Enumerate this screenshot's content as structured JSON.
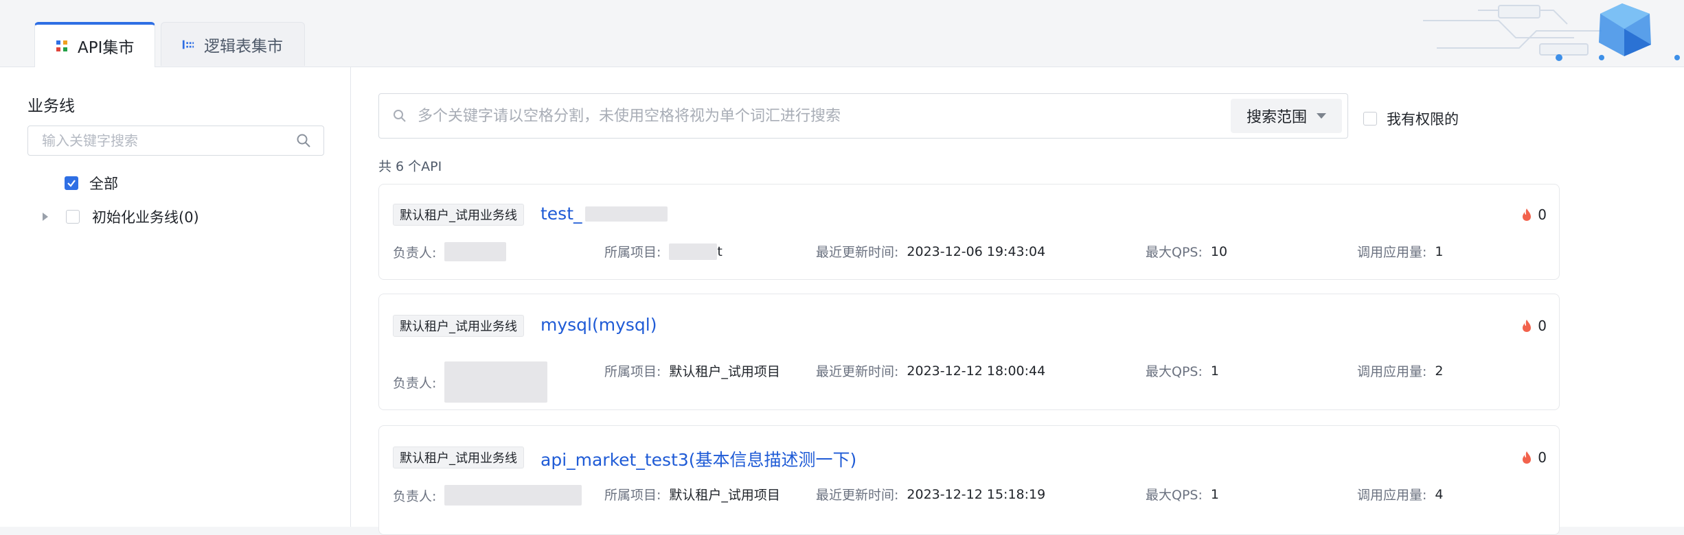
{
  "tabs": [
    {
      "label": "API集市",
      "icon": "grid-icon",
      "active": true
    },
    {
      "label": "逻辑表集市",
      "icon": "table-icon",
      "active": false
    }
  ],
  "sidebar": {
    "title": "业务线",
    "search_placeholder": "输入关键字搜索",
    "all_label": "全部",
    "tree_item": "初始化业务线(0)"
  },
  "search": {
    "placeholder": "多个关键字请以空格分割，未使用空格将视为单个词汇进行搜索",
    "scope_label": "搜索范围",
    "perm_label": "我有权限的"
  },
  "count_label": "共 6 个API",
  "labels": {
    "owner": "负责人:",
    "project": "所属项目:",
    "updated": "最近更新时间:",
    "qps": "最大QPS:",
    "usage": "调用应用量:"
  },
  "cards": [
    {
      "tag": "默认租户_试用业务线",
      "name": "test_",
      "hot": "0",
      "project": "t",
      "updated": "2023-12-06 19:43:04",
      "qps": "10",
      "usage": "1"
    },
    {
      "tag": "默认租户_试用业务线",
      "name": "mysql(mysql)",
      "hot": "0",
      "project": "默认租户_试用项目",
      "updated": "2023-12-12 18:00:44",
      "qps": "1",
      "usage": "2"
    },
    {
      "tag": "默认租户_试用业务线",
      "name": "api_market_test3(基本信息描述测一下)",
      "hot": "0",
      "project": "默认租户_试用项目",
      "updated": "2023-12-12 15:18:19",
      "qps": "1",
      "usage": "4"
    }
  ],
  "colors": {
    "accent": "#2f6fe4",
    "link": "#1f5bd6",
    "hot": "#f2624c"
  }
}
